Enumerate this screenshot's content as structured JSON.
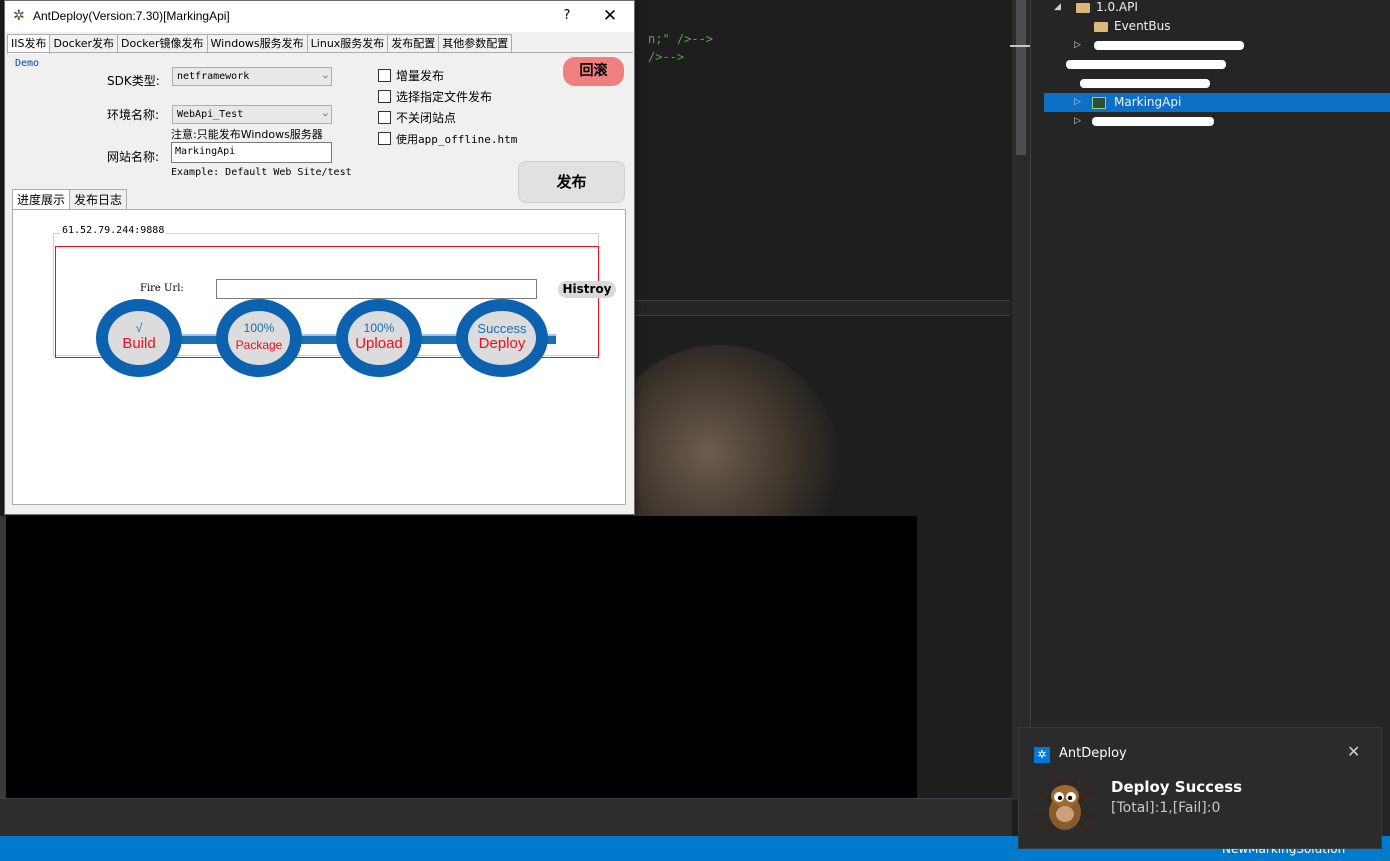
{
  "dialog": {
    "title": "AntDeploy(Version:7.30)[MarkingApi]",
    "help": "?",
    "close": "✕",
    "tabs": [
      "IIS发布",
      "Docker发布",
      "Docker镜像发布",
      "Windows服务发布",
      "Linux服务发布",
      "发布配置",
      "其他参数配置"
    ],
    "active_tab": 0,
    "demo_link": "Demo",
    "sdk_label": "SDK类型:",
    "sdk_value": "netframework",
    "env_label": "环境名称:",
    "env_value": "WebApi_Test",
    "note": "注意:只能发布Windows服务器",
    "site_label": "网站名称:",
    "site_value": "MarkingApi",
    "example": "Example: Default Web Site/test",
    "checkboxes": [
      "增量发布",
      "选择指定文件发布",
      "不关闭站点",
      "使用app_offline.htm"
    ],
    "rollback_label": "回滚",
    "publish_label": "发布",
    "subtabs": [
      "进度展示",
      "发布日志"
    ],
    "progress": {
      "server": "61.52.79.244:9888",
      "fire_url_label": "Fire Url:",
      "fire_url_value": "",
      "history_label": "Histroy",
      "stages": [
        {
          "top": "√",
          "bottom": "Build"
        },
        {
          "top": "100%",
          "bottom": "Package"
        },
        {
          "top": "100%",
          "bottom": "Upload"
        },
        {
          "top": "Success",
          "bottom": "Deploy"
        }
      ]
    }
  },
  "solution_explorer": {
    "rows": [
      {
        "label": "1.0.API",
        "type": "folder"
      },
      {
        "label": "EventBus",
        "type": "folder"
      },
      {
        "label": "MarkingApi",
        "type": "project",
        "selected": true
      }
    ]
  },
  "toast": {
    "app_name": "AntDeploy",
    "close": "✕",
    "title": "Deploy Success",
    "message": "[Total]:1,[Fail]:0"
  },
  "status_bar": {
    "solution_name": "NewMarkingSolution"
  },
  "code_fragments": [
    "n;\" />-->",
    "/>-->"
  ]
}
